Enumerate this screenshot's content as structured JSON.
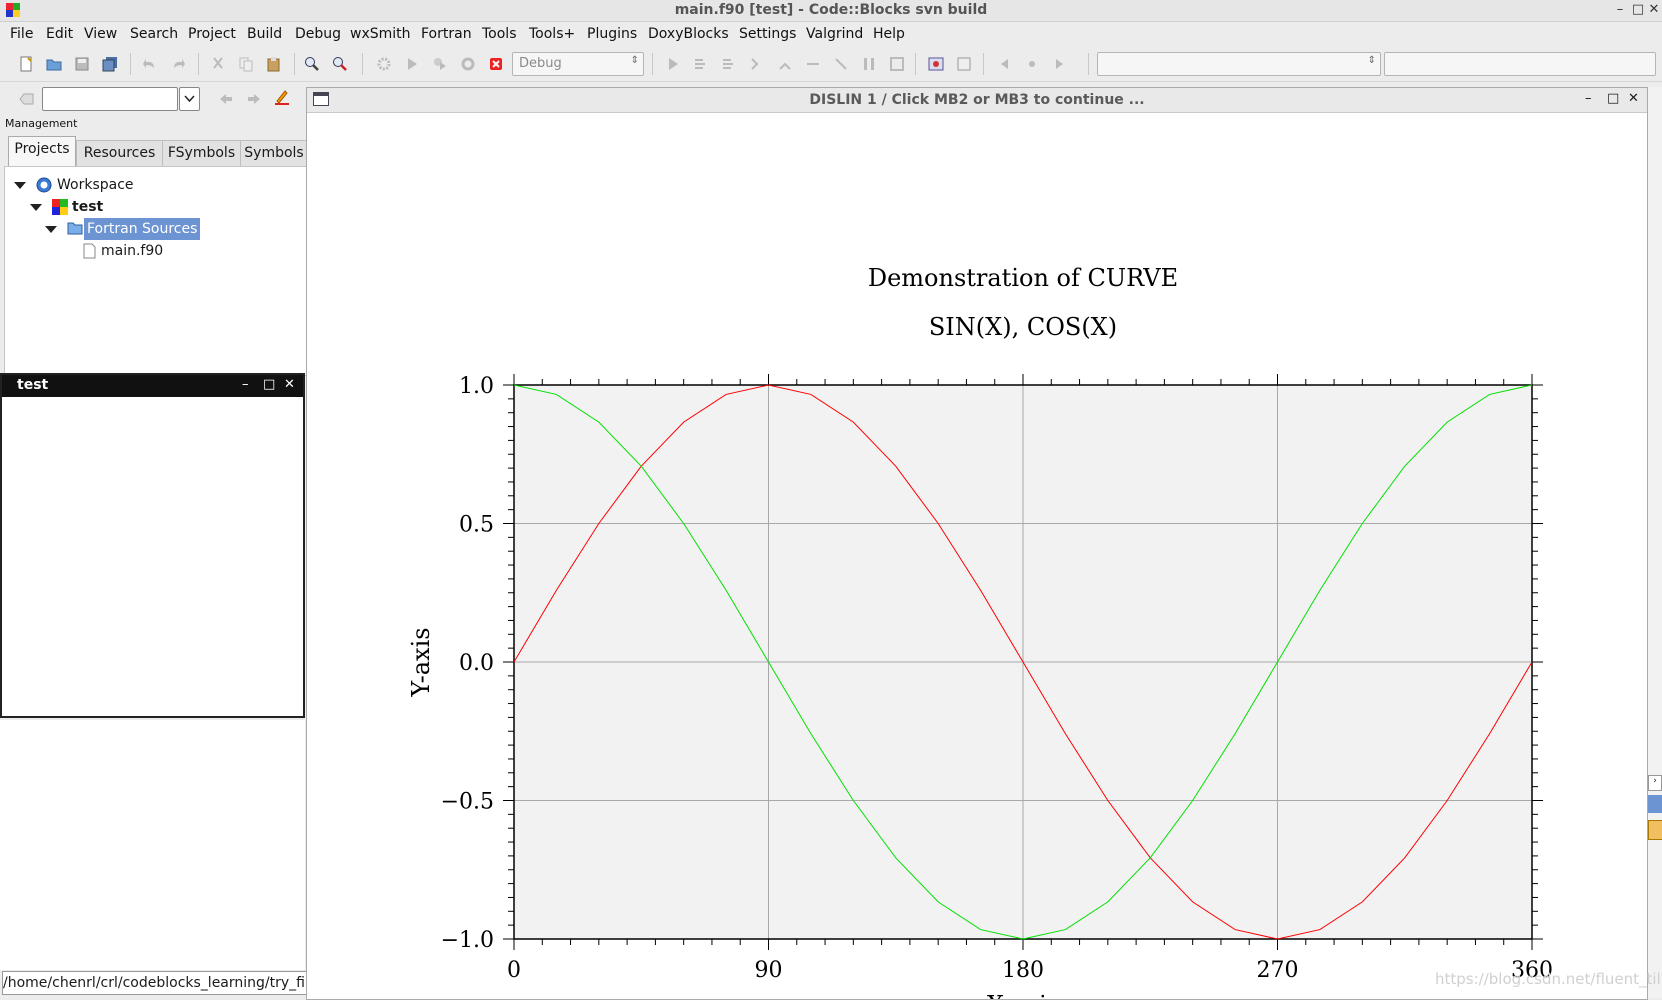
{
  "window": {
    "title": "main.f90 [test] - Code::Blocks svn build"
  },
  "menu": [
    "File",
    "Edit",
    "View",
    "Search",
    "Project",
    "Build",
    "Debug",
    "wxSmith",
    "Fortran",
    "Tools",
    "Tools+",
    "Plugins",
    "DoxyBlocks",
    "Settings",
    "Valgrind",
    "Help"
  ],
  "toolbar": {
    "build_target": "Debug",
    "search_value": ""
  },
  "management": {
    "label": "Management",
    "tabs": [
      "Projects",
      "Resources",
      "FSymbols",
      "Symbols"
    ],
    "tree": {
      "workspace": "Workspace",
      "project": "test",
      "folder": "Fortran Sources",
      "file": "main.f90"
    }
  },
  "test_panel": {
    "title": "test"
  },
  "status": {
    "path": "/home/chenrl/crl/codeblocks_learning/try_firstt"
  },
  "dislin": {
    "title": "DISLIN 1 / Click MB2 or MB3 to continue ..."
  },
  "chart_data": {
    "type": "line",
    "title": "Demonstration of CURVE",
    "subtitle": "SIN(X), COS(X)",
    "xlabel": "X-axis",
    "ylabel": "Y-axis",
    "xlim": [
      0,
      360
    ],
    "ylim": [
      -1.0,
      1.0
    ],
    "xticks": [
      "0",
      "90",
      "180",
      "270",
      "360"
    ],
    "yticks": [
      "1.0",
      "0.5",
      "0.0",
      "−0.5",
      "−1.0"
    ],
    "grid": true,
    "background": "#f2f2f2",
    "series": [
      {
        "color": "#ff0000",
        "x": [
          0,
          15,
          30,
          45,
          60,
          75,
          90,
          105,
          120,
          135,
          150,
          165,
          180,
          195,
          210,
          225,
          240,
          255,
          270,
          285,
          300,
          315,
          330,
          345,
          360
        ],
        "y": [
          0.0,
          0.259,
          0.5,
          0.707,
          0.866,
          0.966,
          1.0,
          0.966,
          0.866,
          0.707,
          0.5,
          0.259,
          0.0,
          -0.259,
          -0.5,
          -0.707,
          -0.866,
          -0.966,
          -1.0,
          -0.966,
          -0.866,
          -0.707,
          -0.5,
          -0.259,
          0.0
        ]
      },
      {
        "color": "#00e000",
        "x": [
          0,
          15,
          30,
          45,
          60,
          75,
          90,
          105,
          120,
          135,
          150,
          165,
          180,
          195,
          210,
          225,
          240,
          255,
          270,
          285,
          300,
          315,
          330,
          345,
          360
        ],
        "y": [
          1.0,
          0.966,
          0.866,
          0.707,
          0.5,
          0.259,
          0.0,
          -0.259,
          -0.5,
          -0.707,
          -0.866,
          -0.966,
          -1.0,
          -0.966,
          -0.866,
          -0.707,
          -0.5,
          -0.259,
          0.0,
          0.259,
          0.5,
          0.707,
          0.866,
          0.966,
          1.0
        ]
      }
    ]
  },
  "watermark": "https://blog.csdn.net/fluent_tili"
}
